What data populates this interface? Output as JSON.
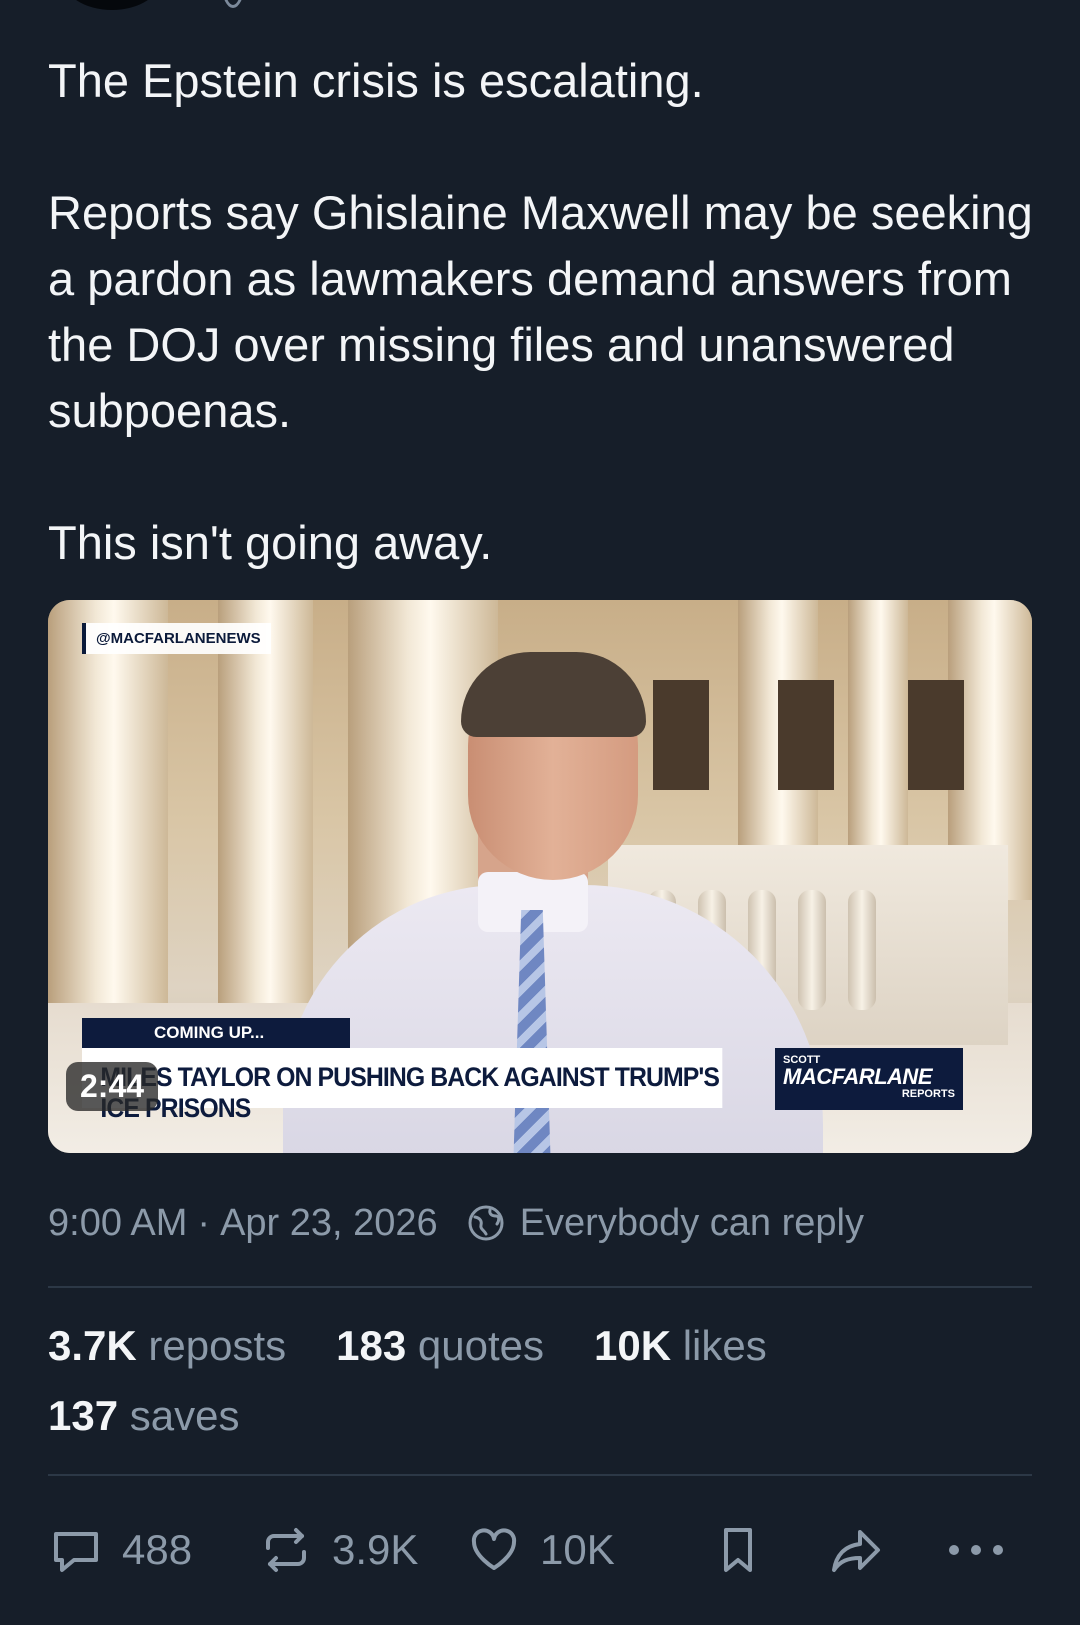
{
  "post": {
    "paragraphs": [
      "The Epstein crisis is escalating.",
      "Reports say Ghislaine Maxwell may be seeking a pardon as lawmakers demand answers from the DOJ over missing files and unanswered subpoenas.",
      "This isn't going away."
    ]
  },
  "video": {
    "watermark": "@MACFARLANENEWS",
    "coming_up": "COMING UP...",
    "headline": "MILES TAYLOR ON PUSHING BACK AGAINST TRUMP'S ICE PRISONS",
    "brand_top": "SCOTT",
    "brand_main": "MACFARLANE",
    "brand_sub": "REPORTS",
    "duration": "2:44"
  },
  "meta": {
    "time": "9:00 AM",
    "separator": "·",
    "date": "Apr 23, 2026",
    "reply_setting": "Everybody can reply"
  },
  "stats": {
    "reposts_count": "3.7K",
    "reposts_label": "reposts",
    "quotes_count": "183",
    "quotes_label": "quotes",
    "likes_count": "10K",
    "likes_label": "likes",
    "saves_count": "137",
    "saves_label": "saves"
  },
  "actions": {
    "replies": "488",
    "reposts": "3.9K",
    "likes": "10K"
  },
  "icons": {
    "reply": "speech-bubble-icon",
    "repost": "repost-arrows-icon",
    "like": "heart-icon",
    "bookmark": "bookmark-icon",
    "share": "share-arrow-icon",
    "more": "more-dots-icon",
    "globe": "globe-icon"
  },
  "colors": {
    "background": "#161e29",
    "text": "#f3f5f7",
    "muted": "#8c9aa9",
    "divider": "#2c3846"
  }
}
